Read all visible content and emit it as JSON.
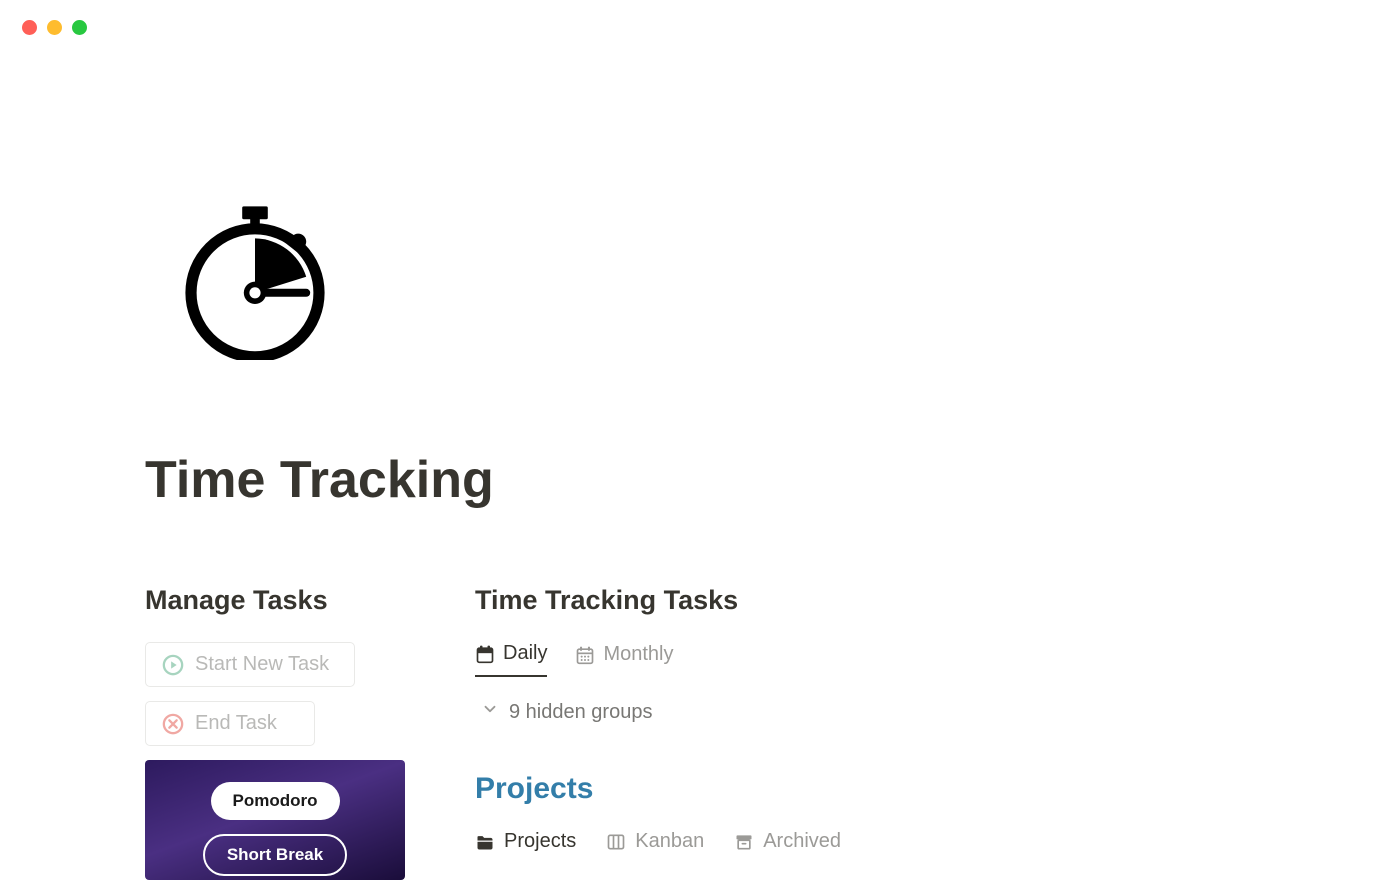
{
  "page": {
    "title": "Time Tracking"
  },
  "manage": {
    "heading": "Manage Tasks",
    "start_label": "Start New Task",
    "end_label": "End Task"
  },
  "pomodoro": {
    "pomodoro_label": "Pomodoro",
    "short_break_label": "Short Break"
  },
  "tracking": {
    "heading": "Time Tracking Tasks",
    "tabs": {
      "daily": "Daily",
      "monthly": "Monthly"
    },
    "hidden_groups": "9 hidden groups"
  },
  "projects": {
    "heading": "Projects",
    "tabs": {
      "projects": "Projects",
      "kanban": "Kanban",
      "archived": "Archived"
    }
  }
}
